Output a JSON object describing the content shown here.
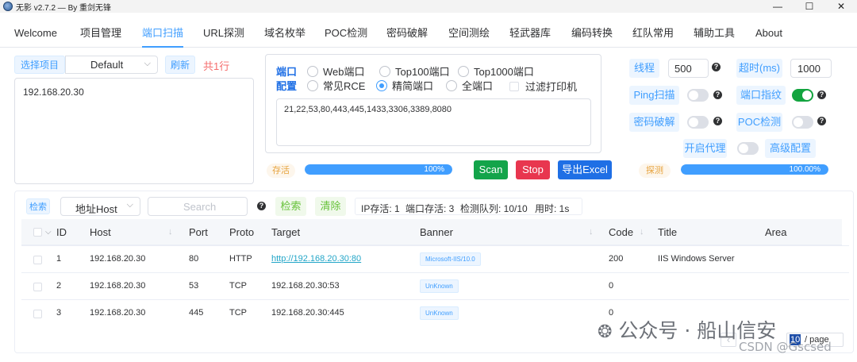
{
  "window": {
    "title": "无影 v2.7.2 — By 重剑无锋",
    "controls": {
      "minimize": "—",
      "maximize": "☐",
      "close": "✕"
    }
  },
  "menu": [
    {
      "label": "Welcome",
      "active": false
    },
    {
      "label": "项目管理",
      "active": false
    },
    {
      "label": "端口扫描",
      "active": true
    },
    {
      "label": "URL探测",
      "active": false
    },
    {
      "label": "域名枚举",
      "active": false
    },
    {
      "label": "POC检测",
      "active": false
    },
    {
      "label": "密码破解",
      "active": false
    },
    {
      "label": "空间测绘",
      "active": false
    },
    {
      "label": "轻武器库",
      "active": false
    },
    {
      "label": "编码转换",
      "active": false
    },
    {
      "label": "红队常用",
      "active": false
    },
    {
      "label": "辅助工具",
      "active": false
    },
    {
      "label": "About",
      "active": false
    }
  ],
  "project": {
    "select_label": "选择项目",
    "selected": "Default",
    "refresh_label": "刷新",
    "line_count": "共1行",
    "targets": "192.168.20.30"
  },
  "ports": {
    "port_label": "端口",
    "config_label": "配置",
    "options": [
      {
        "label": "Web端口",
        "checked": false
      },
      {
        "label": "Top100端口",
        "checked": false
      },
      {
        "label": "Top1000端口",
        "checked": false
      },
      {
        "label": "常见RCE",
        "checked": false
      },
      {
        "label": "精简端口",
        "checked": true
      },
      {
        "label": "全端口",
        "checked": false
      }
    ],
    "filter_printer_label": "过滤打印机",
    "port_list": "21,22,53,80,443,445,1433,3306,3389,8080"
  },
  "alive": {
    "label": "存活",
    "progress": 1.0,
    "progress_text": "100%"
  },
  "actions": {
    "scan": "Scan",
    "stop": "Stop",
    "export": "导出Excel"
  },
  "settings": {
    "threads_label": "线程",
    "threads_value": "500",
    "timeout_label": "超时(ms)",
    "timeout_value": "1000",
    "ping_label": "Ping扫描",
    "ping_on": false,
    "fingerprint_label": "端口指纹",
    "fingerprint_on": true,
    "brute_label": "密码破解",
    "brute_on": false,
    "poc_label": "POC检测",
    "poc_on": false,
    "proxy_label": "开启代理",
    "proxy_on": false,
    "advanced_label": "高级配置",
    "help_glyph": "?"
  },
  "detect": {
    "label": "探测",
    "progress": 1.0,
    "progress_text": "100.00%"
  },
  "results": {
    "search_tag": "检索",
    "filter_field": "地址Host",
    "search_placeholder": "Search",
    "search_button": "检索",
    "clear_button": "清除",
    "stats": {
      "ip_alive": "IP存活: 1",
      "port_alive": "端口存活: 3",
      "queue": "检测队列: 10/10",
      "time": "用时: 1s"
    },
    "columns": [
      "ID",
      "Host",
      "Port",
      "Proto",
      "Target",
      "Banner",
      "Code",
      "Title",
      "Area"
    ],
    "rows": [
      {
        "id": "1",
        "host": "192.168.20.30",
        "port": "80",
        "proto": "HTTP",
        "target": "http://192.168.20.30:80",
        "target_is_link": true,
        "banner": "Microsoft-IIS/10.0",
        "code": "200",
        "title": "IIS Windows Server",
        "area": ""
      },
      {
        "id": "2",
        "host": "192.168.20.30",
        "port": "53",
        "proto": "TCP",
        "target": "192.168.20.30:53",
        "target_is_link": false,
        "banner": "UnKnown",
        "code": "0",
        "title": "",
        "area": ""
      },
      {
        "id": "3",
        "host": "192.168.20.30",
        "port": "445",
        "proto": "TCP",
        "target": "192.168.20.30:445",
        "target_is_link": false,
        "banner": "UnKnown",
        "code": "0",
        "title": "",
        "area": ""
      }
    ],
    "pagination": {
      "prev": "‹",
      "page_size": "10",
      "per_page": "/ page"
    }
  },
  "watermark": {
    "brand": "公众号 · 船山信安",
    "csdn": "CSDN @Gscsed"
  },
  "colors": {
    "accent": "#409eff",
    "scan": "#13a44a",
    "stop": "#e8364f",
    "export": "#1f6fe5",
    "danger_text": "#f56c6c",
    "link": "#23a6c8"
  }
}
